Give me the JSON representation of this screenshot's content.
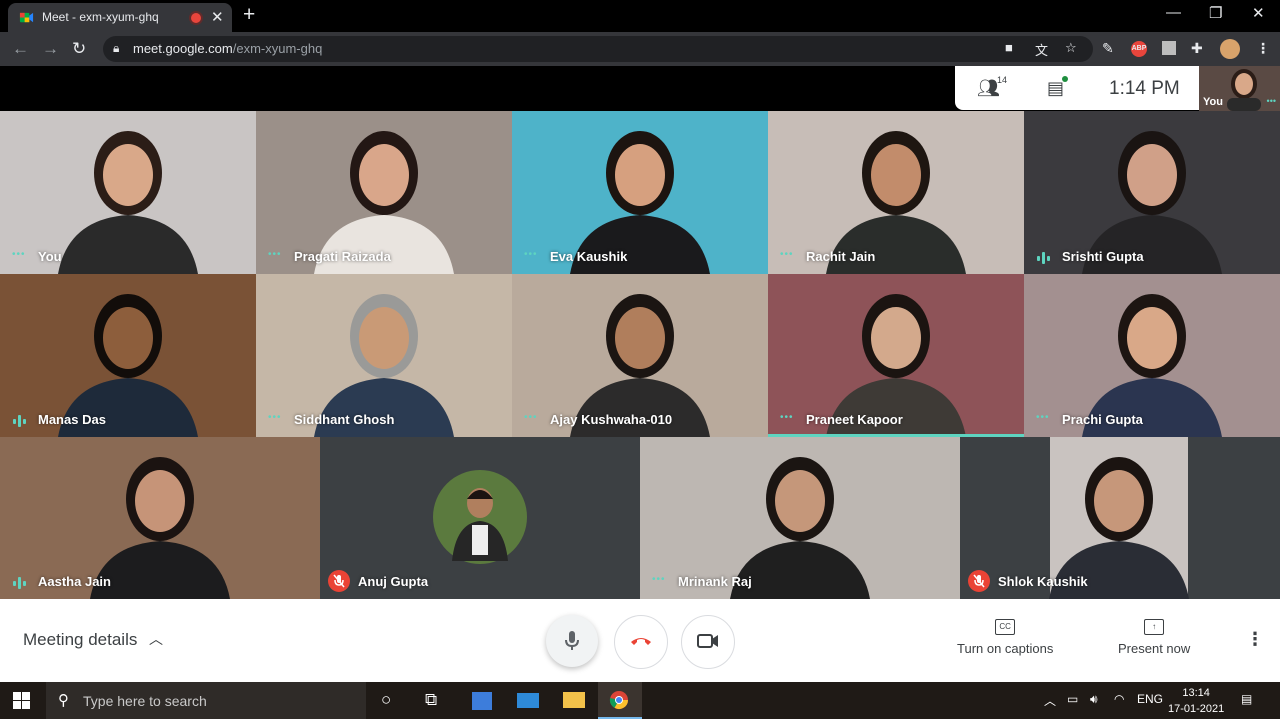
{
  "browser": {
    "tab_title": "Meet - exm-xyum-ghq",
    "url_host": "meet.google.com",
    "url_path": "/exm-xyum-ghq"
  },
  "meet": {
    "participants_count": "14",
    "time": "1:14 PM",
    "self_label": "You",
    "accent_color": "#5ed4c0",
    "tiles": [
      {
        "name": "You",
        "status": "dots",
        "bg": "#c9c5c4",
        "skin": "#d9a889",
        "hair": "#2b1d17",
        "shirt": "#2a2a2a"
      },
      {
        "name": "Pragati Raizada",
        "status": "dots",
        "bg": "#9b9089",
        "skin": "#d9a68a",
        "hair": "#231714",
        "shirt": "#e9e4df"
      },
      {
        "name": "Eva Kaushik",
        "status": "dots",
        "bg": "#4eb3c9",
        "skin": "#d6a07f",
        "hair": "#1c1410",
        "shirt": "#1a1a1c"
      },
      {
        "name": "Rachit Jain",
        "status": "dots",
        "bg": "#c7bdb7",
        "skin": "#c28c6b",
        "hair": "#1e1611",
        "shirt": "#2a2d2b"
      },
      {
        "name": "Srishti Gupta",
        "status": "wave",
        "bg": "#3b3a3e",
        "skin": "#d0a088",
        "hair": "#1a1412",
        "shirt": "#252426"
      },
      {
        "name": "Manas Das",
        "status": "wave",
        "bg": "#7a5236",
        "skin": "#8d5e3c",
        "hair": "#120d0a",
        "shirt": "#1e2a3a"
      },
      {
        "name": "Siddhant Ghosh",
        "status": "dots",
        "bg": "#c5b7a7",
        "skin": "#c99a76",
        "hair": "#9a9a98",
        "shirt": "#2b3b52"
      },
      {
        "name": "Ajay Kushwaha-010",
        "status": "dots",
        "bg": "#b9aa9c",
        "skin": "#b07e5c",
        "hair": "#1b1512",
        "shirt": "#2c2b2b"
      },
      {
        "name": "Praneet Kapoor",
        "status": "dots",
        "bg": "#8e5358",
        "skin": "#d3a98c",
        "hair": "#1b1411",
        "shirt": "#3e3a36"
      },
      {
        "name": "Prachi Gupta",
        "status": "dots",
        "bg": "#a39090",
        "skin": "#d9a888",
        "hair": "#1d1512",
        "shirt": "#2b3550"
      },
      {
        "name": "Aastha Jain",
        "status": "wave",
        "bg": "#8a6a54",
        "skin": "#c69478",
        "hair": "#1b1311",
        "shirt": "#1c1c1e"
      },
      {
        "name": "Anuj Gupta",
        "status": "muted",
        "bg": "#3c4043",
        "skin": "#b07f5e",
        "hair": "#1b1411",
        "shirt": "#262626"
      },
      {
        "name": "Mrinank Raj",
        "status": "dots",
        "bg": "#bdb7b2",
        "skin": "#c5977a",
        "hair": "#1b1512",
        "shirt": "#1f1f1f"
      },
      {
        "name": "Shlok Kaushik",
        "status": "muted",
        "bg": "#3c4043",
        "skin": "#c6977a",
        "hair": "#1b1411",
        "shirt": "#2a2d35"
      }
    ]
  },
  "controls": {
    "meeting_details": "Meeting details",
    "captions_label": "Turn on captions",
    "present_label": "Present now",
    "end_call_color": "#ea4335"
  },
  "taskbar": {
    "search_placeholder": "Type here to search",
    "language": "ENG",
    "clock_time": "13:14",
    "clock_date": "17-01-2021"
  }
}
